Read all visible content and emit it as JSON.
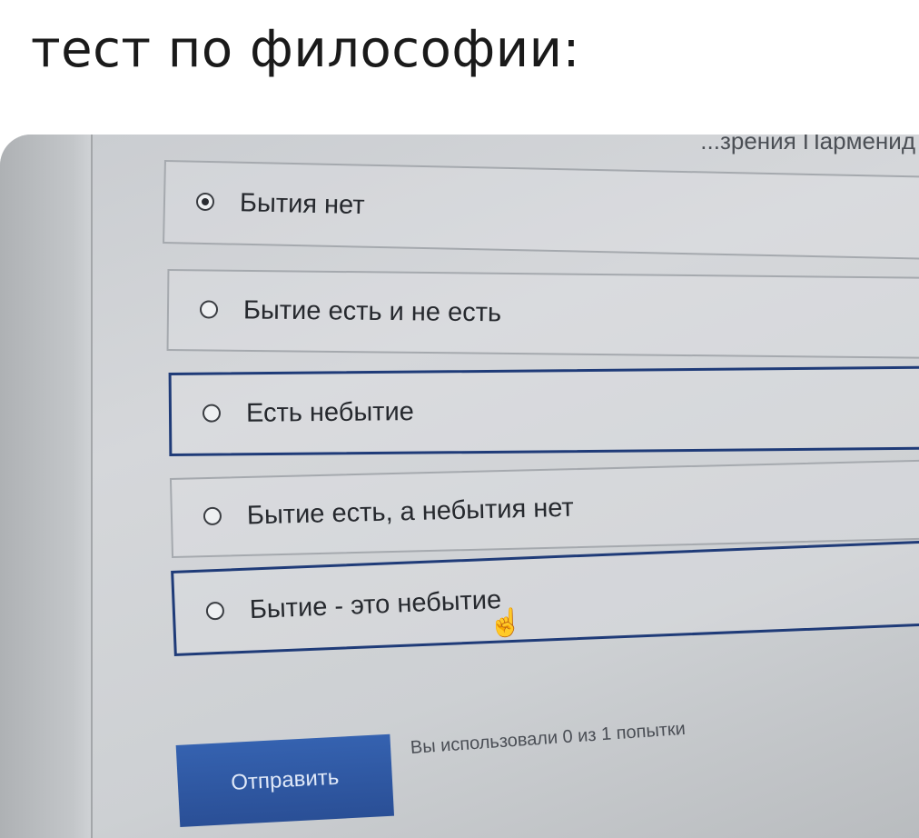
{
  "caption": "тест по философии:",
  "question_fragment": "...зрения Парменид",
  "options": [
    {
      "label": "Бытия нет",
      "selected": true
    },
    {
      "label": "Бытие есть и не есть",
      "selected": false
    },
    {
      "label": "Есть небытие",
      "selected": false
    },
    {
      "label": "Бытие есть, а небытия нет",
      "selected": false
    },
    {
      "label": "Бытие - это небытие",
      "selected": false
    }
  ],
  "submit_label": "Отправить",
  "attempts_text": "Вы использовали 0 из 1 попытки",
  "cursor_icon": "hand-pointer-icon",
  "colors": {
    "button": "#2f5aa6",
    "focus_border": "#1f3b78"
  }
}
